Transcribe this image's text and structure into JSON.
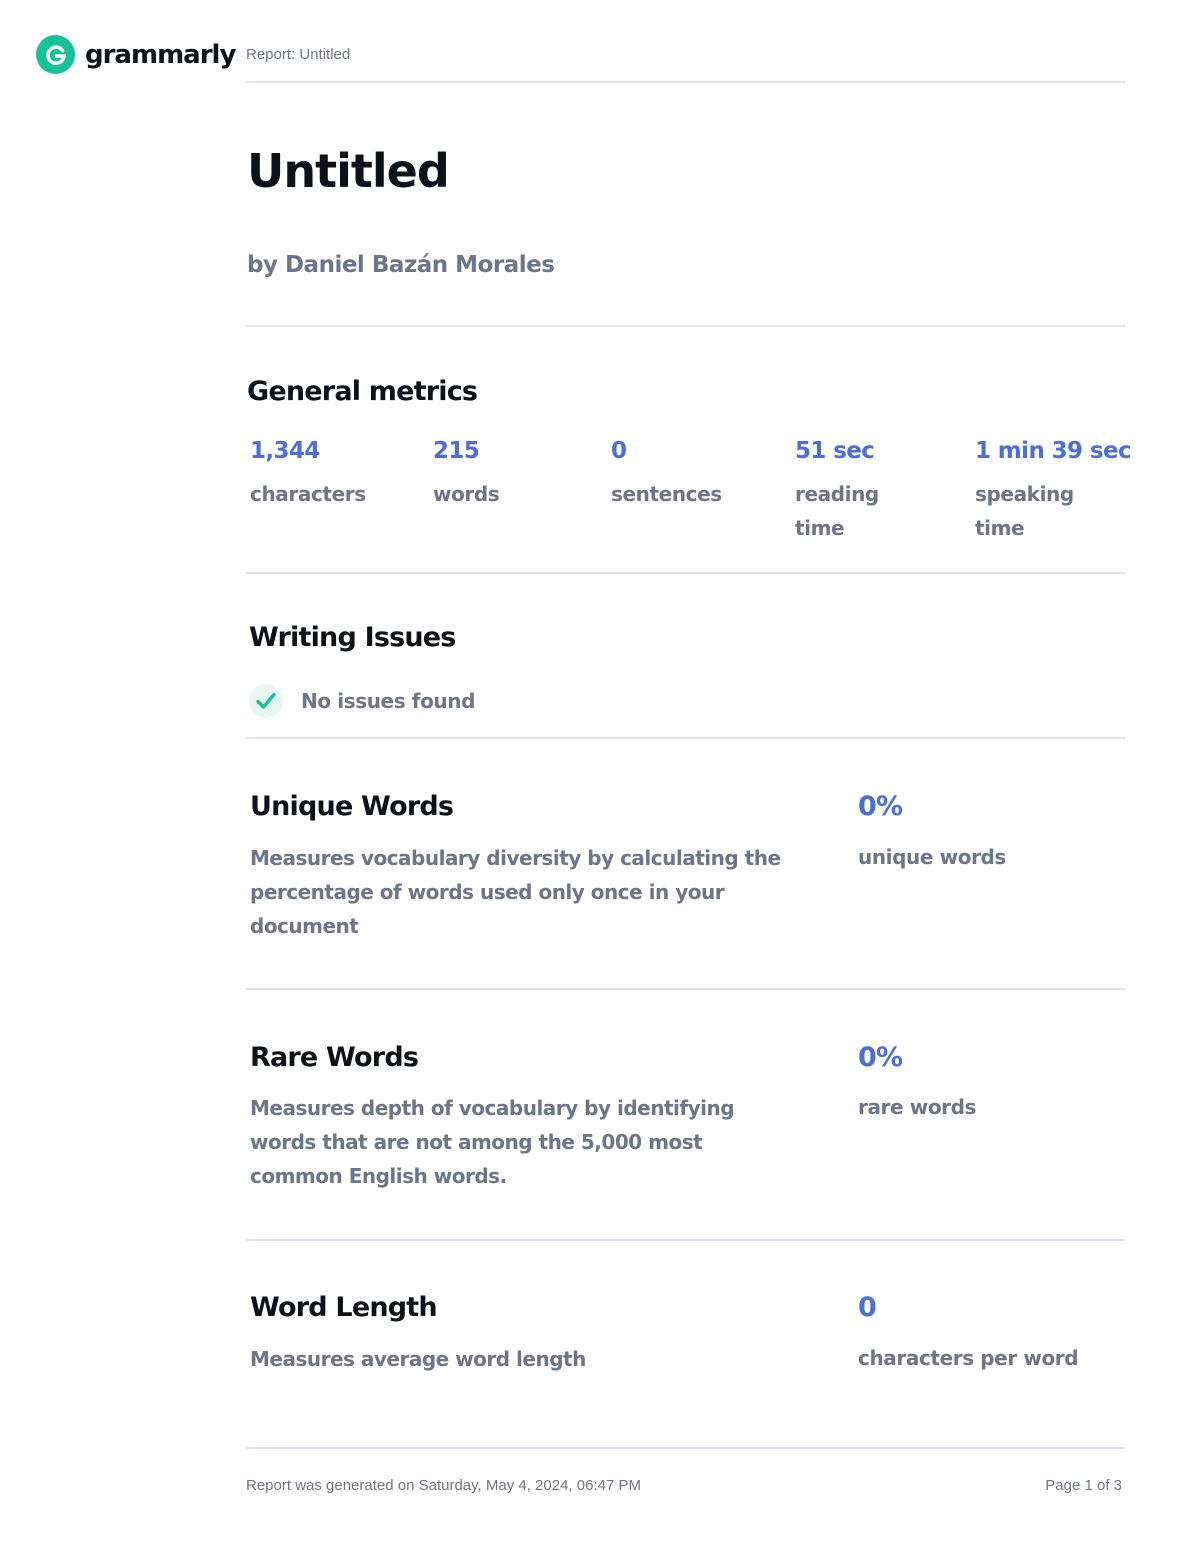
{
  "brand": {
    "name": "grammarly",
    "logo_letter": "G",
    "accent_color": "#15c39a",
    "logo_icon": "grammarly-g-icon"
  },
  "header": {
    "report_label": "Report: Untitled"
  },
  "document": {
    "title": "Untitled",
    "author": "by Daniel Bazán Morales"
  },
  "general_metrics": {
    "title": "General metrics",
    "value_color": "#4a6ee0",
    "items": [
      {
        "value": "1,344",
        "label": "characters"
      },
      {
        "value": "215",
        "label": "words"
      },
      {
        "value": "0",
        "label": "sentences"
      },
      {
        "value": "51 sec",
        "label": "reading time"
      },
      {
        "value": "1 min 39 sec",
        "label": "speaking time"
      }
    ]
  },
  "writing_issues": {
    "title": "Writing Issues",
    "status_icon": "check-icon",
    "status_text": "No issues found"
  },
  "unique_words": {
    "title": "Unique Words",
    "description": "Measures vocabulary diversity by calculating the percentage of words used only once in your document",
    "value": "0%",
    "value_label": "unique words"
  },
  "rare_words": {
    "title": "Rare Words",
    "description": "Measures depth of vocabulary by identifying words that are not among the 5,000 most common English words.",
    "value": "0%",
    "value_label": "rare words"
  },
  "word_length": {
    "title": "Word Length",
    "description": "Measures average word length",
    "value": "0",
    "value_label": "characters per word"
  },
  "footer": {
    "generated": "Report was generated on Saturday, May 4, 2024, 06:47 PM",
    "page": "Page 1 of 3"
  }
}
